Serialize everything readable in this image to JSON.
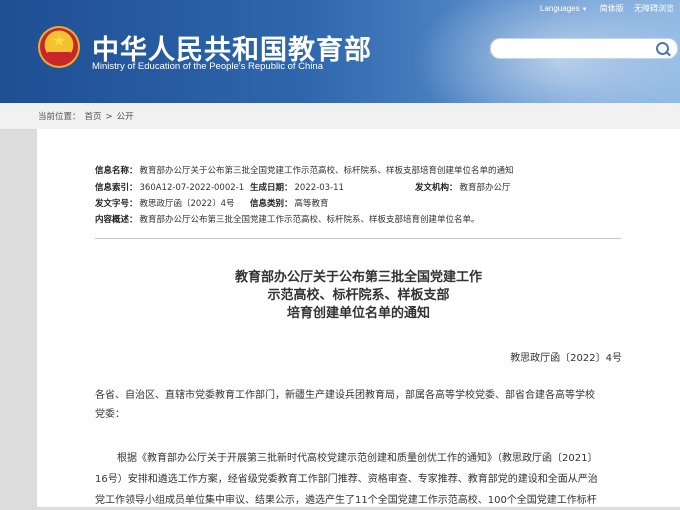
{
  "header": {
    "title_cn": "中华人民共和国教育部",
    "title_en": "Ministry of Education of the People's Republic of China",
    "links": [
      "Languages",
      "简体版",
      "无障碍浏览"
    ],
    "search_placeholder": ""
  },
  "breadcrumb": {
    "prefix": "当前位置：",
    "items": [
      "首页",
      "公开"
    ],
    "separator": ">"
  },
  "meta": {
    "name_label": "信息名称：",
    "name_value": "教育部办公厅关于公布第三批全国党建工作示范高校、标杆院系、样板支部培育创建单位名单的通知",
    "index_label": "信息索引：",
    "index_value": "360A12-07-2022-0002-1",
    "date_label": "生成日期：",
    "date_value": "2022-03-11",
    "issuer_label": "发文机构：",
    "issuer_value": "教育部办公厅",
    "docno_label": "发文字号：",
    "docno_value": "教思政厅函〔2022〕4号",
    "category_label": "信息类别：",
    "category_value": "高等教育",
    "summary_label": "内容概述：",
    "summary_value": "教育部办公厅公布第三批全国党建工作示范高校、标杆院系、样板支部培育创建单位名单。"
  },
  "document": {
    "title_lines": [
      "教育部办公厅关于公布第三批全国党建工作",
      "示范高校、标杆院系、样板支部",
      "培育创建单位名单的通知"
    ],
    "doc_number": "教思政厅函〔2022〕4号",
    "salutation_line1": "各省、自治区、直辖市党委教育工作部门，新疆生产建设兵团教育局，部属各高等学校党委、部省合建各高等学校",
    "salutation_line2": "党委：",
    "body_line1": "根据《教育部办公厅关于开展第三批新时代高校党建示范创建和质量创优工作的通知》（教思政厅函〔2021〕",
    "body_line2": "16号）安排和遴选工作方案，经省级党委教育工作部门推荐、资格审查、专家推荐、教育部党的建设和全面从严治",
    "body_line3": "党工作领导小组成员单位集中审议、结果公示，遴选产生了11个全国党建工作示范高校、100个全国党建工作标杆"
  }
}
